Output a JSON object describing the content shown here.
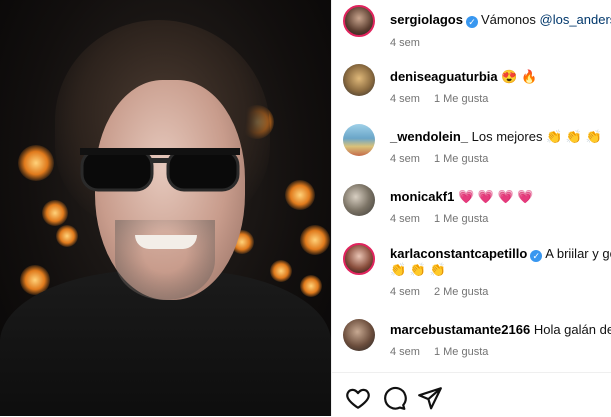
{
  "photo": {
    "description_alt": ""
  },
  "comments": [
    {
      "user": "sergiolagos",
      "verified": true,
      "text": "Vámonos ",
      "mention": "@los_andersen",
      "time": "4 sem",
      "likes": ""
    },
    {
      "user": "deniseaguaturbia",
      "verified": false,
      "text": "😍 🔥",
      "mention": "",
      "time": "4 sem",
      "likes": "1 Me gusta"
    },
    {
      "user": "_wendolein_",
      "verified": false,
      "text": "Los mejores 👏 👏 👏",
      "mention": "",
      "time": "4 sem",
      "likes": "1 Me gusta"
    },
    {
      "user": "monicakf1",
      "verified": false,
      "text": "💗 💗 💗 💗",
      "mention": "",
      "time": "4 sem",
      "likes": "1 Me gusta"
    },
    {
      "user": "karlaconstantcapetillo",
      "verified": true,
      "text": "A briilar y goza",
      "text2": "👏 👏 👏",
      "mention": "",
      "time": "4 sem",
      "likes": "2 Me gusta"
    },
    {
      "user": "marcebustamante2166",
      "verified": false,
      "text": "Hola galán de to",
      "mention": "",
      "time": "4 sem",
      "likes": "1 Me gusta"
    }
  ],
  "actions": {
    "like": "heart-icon",
    "comment": "comment-icon",
    "share": "share-icon"
  },
  "colors": {
    "accent": "#3897f0",
    "meta": "#737373"
  }
}
